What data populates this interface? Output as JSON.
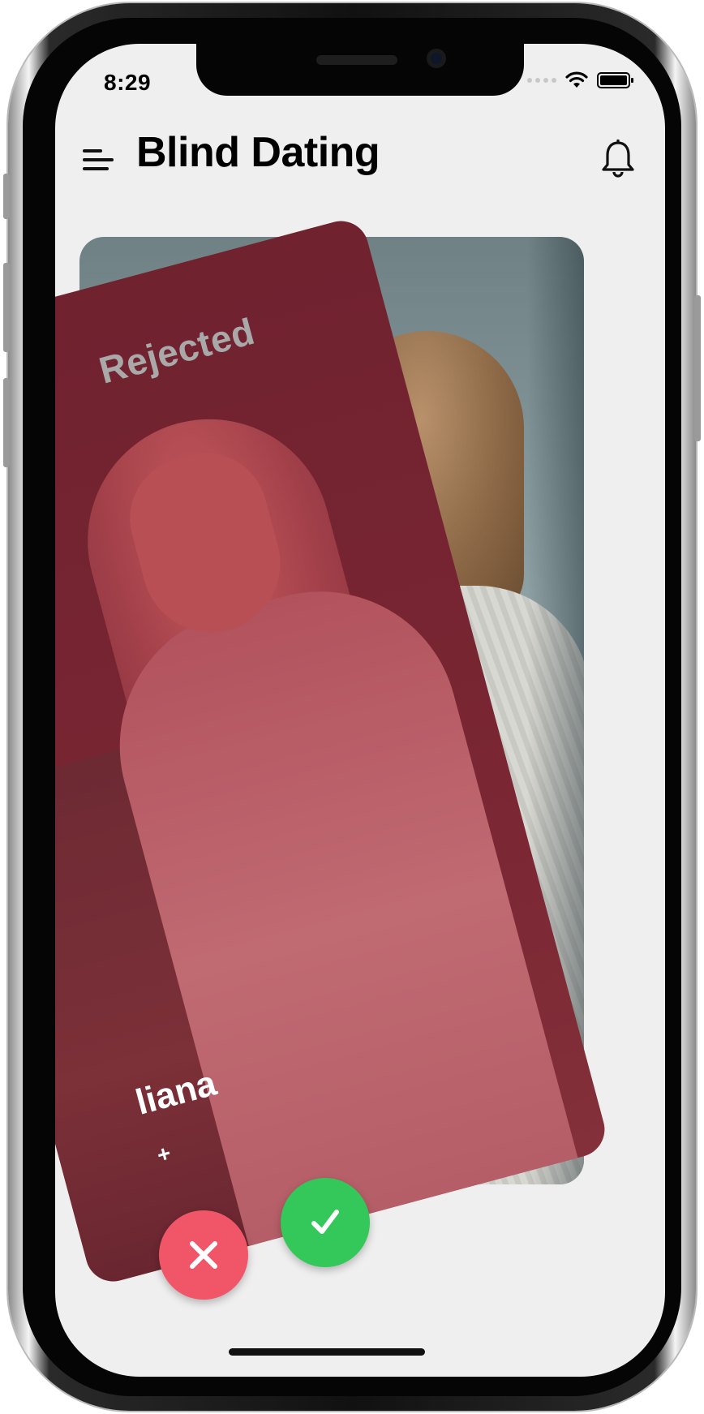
{
  "status_bar": {
    "time": "8:29"
  },
  "header": {
    "title": "Blind Dating"
  },
  "card_front": {
    "stamp": "Rejected",
    "name": "liana",
    "extra": "+"
  },
  "actions": {
    "reject_icon": "close-icon",
    "accept_icon": "checkmark-icon"
  },
  "colors": {
    "reject": "#f05668",
    "accept": "#34c759",
    "rejected_overlay": "#7a2633",
    "screen_bg": "#efefef"
  }
}
